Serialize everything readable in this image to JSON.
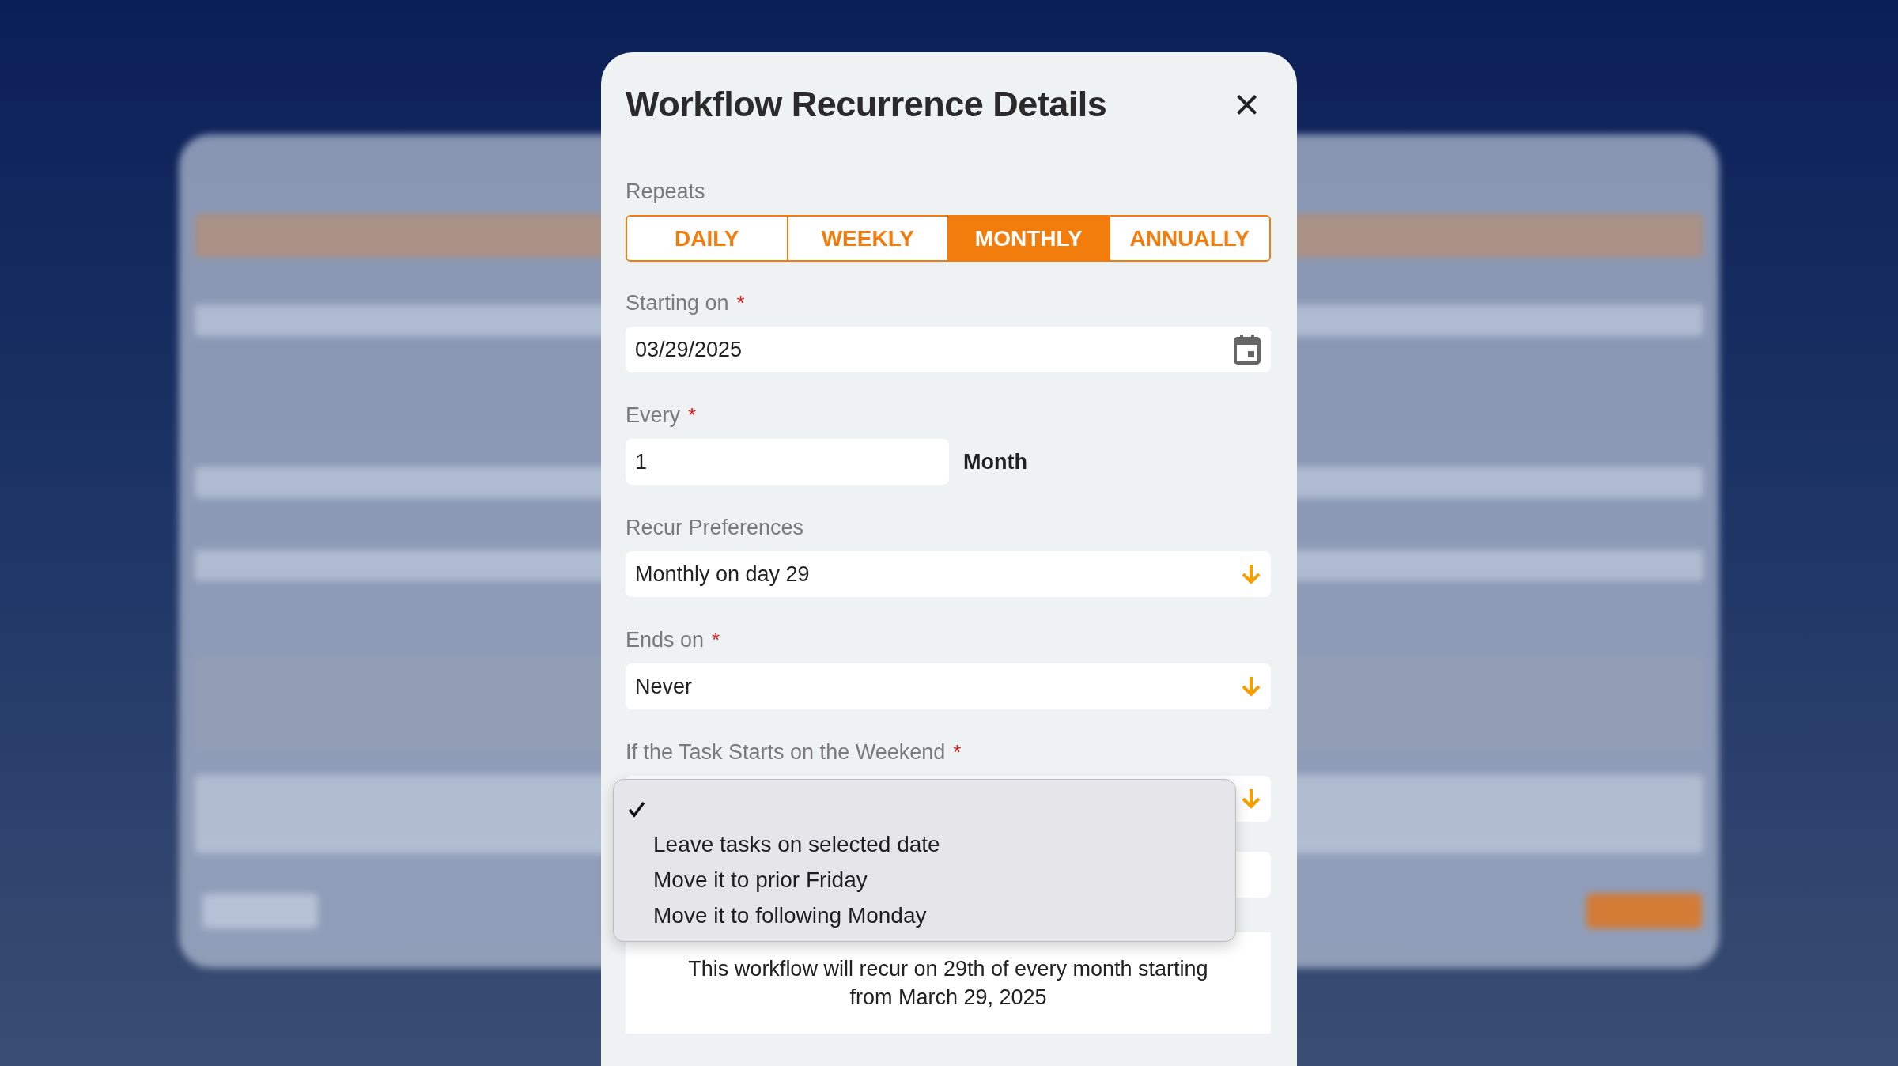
{
  "dialog": {
    "title": "Workflow Recurrence Details",
    "close": "×"
  },
  "repeats": {
    "label": "Repeats",
    "tabs": [
      {
        "label": "DAILY",
        "selected": false
      },
      {
        "label": "WEEKLY",
        "selected": false
      },
      {
        "label": "MONTHLY",
        "selected": true
      },
      {
        "label": "ANNUALLY",
        "selected": false
      }
    ]
  },
  "starting_on": {
    "label": "Starting on",
    "required_mark": "*",
    "value": "03/29/2025"
  },
  "every": {
    "label": "Every",
    "required_mark": "*",
    "value": "1",
    "unit": "Month"
  },
  "recur_preferences": {
    "label": "Recur Preferences",
    "value": "Monthly on day 29"
  },
  "ends_on": {
    "label": "Ends on",
    "required_mark": "*",
    "value": "Never"
  },
  "weekend": {
    "label": "If the Task Starts on the Weekend",
    "required_mark": "*",
    "menu": [
      {
        "selected": true
      },
      {
        "label": "Leave tasks on selected date",
        "selected": false
      },
      {
        "label": "Move it to prior Friday",
        "selected": false
      },
      {
        "label": "Move it to following Monday",
        "selected": false
      }
    ]
  },
  "summary": "This workflow will recur on 29th of every month starting from March 29, 2025"
}
